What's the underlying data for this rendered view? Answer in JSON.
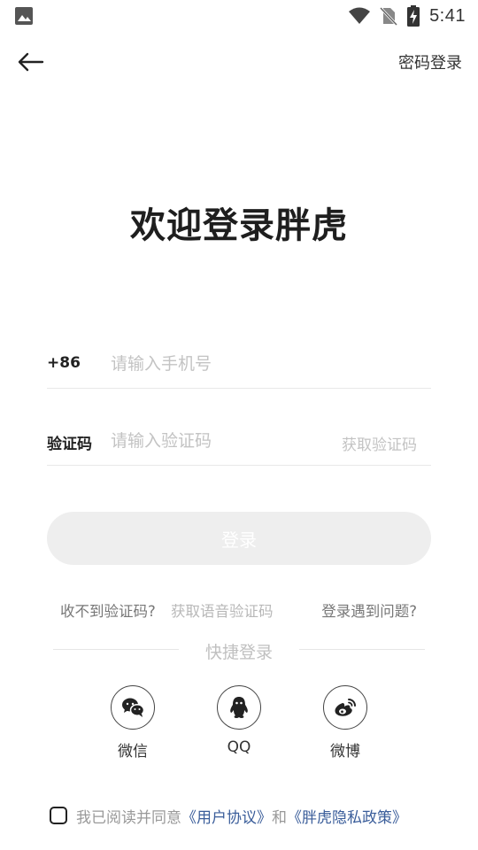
{
  "status_bar": {
    "time": "5:41",
    "left_icon": "image-icon",
    "icons": [
      "wifi-icon",
      "no-sim-icon",
      "battery-charging-icon"
    ]
  },
  "topbar": {
    "back_icon": "arrow-left-icon",
    "password_login": "密码登录"
  },
  "welcome_title": "欢迎登录胖虎",
  "phone": {
    "prefix": "+86",
    "placeholder": "请输入手机号",
    "value": ""
  },
  "code": {
    "prefix": "验证码",
    "placeholder": "请输入验证码",
    "value": "",
    "get_code": "获取验证码"
  },
  "login_button": "登录",
  "help": {
    "no_code": "收不到验证码?",
    "voice_code": "获取语音验证码",
    "problem": "登录遇到问题?"
  },
  "quick_login": {
    "label": "快捷登录",
    "options": [
      {
        "name": "微信",
        "icon": "wechat-icon"
      },
      {
        "name": "QQ",
        "icon": "qq-icon"
      },
      {
        "name": "微博",
        "icon": "weibo-icon"
      }
    ]
  },
  "agreement": {
    "checked": false,
    "prefix": "我已阅读并同意",
    "user_agreement": "《用户协议》",
    "and": "和",
    "privacy_policy": "《胖虎隐私政策》"
  },
  "colors": {
    "link": "#3a5d9a",
    "placeholder": "#c3c3c3",
    "button_disabled_bg": "#eeeeee",
    "title": "#1e1e1e"
  }
}
